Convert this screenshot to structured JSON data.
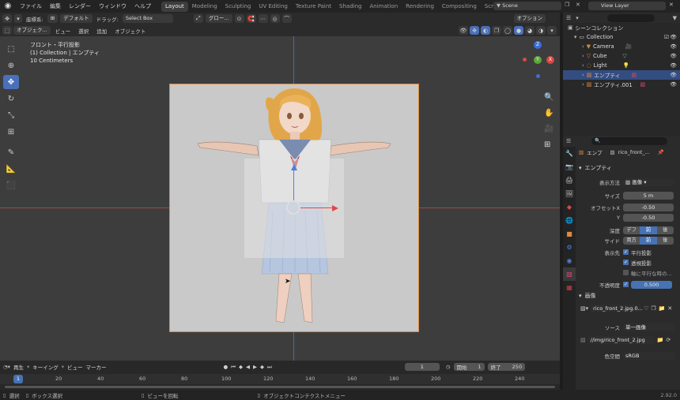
{
  "menu": [
    "ファイル",
    "編集",
    "レンダー",
    "ウィンドウ",
    "ヘルプ"
  ],
  "workspaces": [
    "Layout",
    "Modeling",
    "Sculpting",
    "UV Editing",
    "Texture Paint",
    "Shading",
    "Animation",
    "Rendering",
    "Compositing",
    "Scripting"
  ],
  "scene": "Scene",
  "view_layer": "View Layer",
  "header": {
    "coord_label": "座標系:",
    "coord_value": "デフォルト",
    "drag_label": "ドラッグ:",
    "drag_value": "Select Box",
    "pivot": "グロー...",
    "options": "オプション"
  },
  "header2": {
    "mode": "オブジェク...",
    "items": [
      "ビュー",
      "選択",
      "追加",
      "オブジェクト"
    ]
  },
  "overlay": {
    "view_name": "フロント・平行投影",
    "collection_info": "(1) Collection | エンプティ",
    "scale": "10 Centimeters"
  },
  "gizmo": {
    "z": "Z",
    "y": "Y",
    "x": "X"
  },
  "outliner": {
    "root": "シーンコレクション",
    "collection": "Collection",
    "items": [
      "Camera",
      "Cube",
      "Light",
      "エンプティ",
      "エンプティ.001"
    ]
  },
  "props": {
    "search": "",
    "crumb1": "エンプ",
    "crumb2": "rico_front_...",
    "section": "エンプティ",
    "display_label": "表示方法",
    "display_value": "画像",
    "size_label": "サイズ",
    "size_value": "5 m",
    "offset_x_label": "オフセットX",
    "offset_x": "-0.50",
    "offset_y_label": "Y",
    "offset_y": "-0.50",
    "depth_label": "深度",
    "depth_opts": [
      "デフ",
      "前",
      "後"
    ],
    "side_label": "サイド",
    "side_opts": [
      "両方",
      "前",
      "後"
    ],
    "show_label": "表示先",
    "show_ortho": "平行投影",
    "show_persp": "透視投影",
    "show_axis": "軸に平行な時の...",
    "opacity_label": "不透明度",
    "opacity_value": "0.500",
    "image_section": "画像",
    "image_file": "rico_front_2.jpg.0...",
    "source_label": "ソース",
    "source_value": "単一画像",
    "path_value": "//img/rico_front_2.jpg",
    "colorspace_label": "色空間",
    "colorspace_value": "sRGB"
  },
  "timeline": {
    "playback": "再生",
    "keying": "キーイング",
    "view": "ビュー",
    "marker": "マーカー",
    "current": "1",
    "start_label": "開始",
    "start": "1",
    "end_label": "終了",
    "end": "250",
    "ticks": [
      "1",
      "20",
      "40",
      "60",
      "80",
      "100",
      "120",
      "140",
      "160",
      "180",
      "200",
      "220",
      "240"
    ]
  },
  "status": {
    "select": "選択",
    "box_select": "ボックス選択",
    "rotate": "ビューを回転",
    "context": "オブジェクトコンテクストメニュー",
    "version": "2.92.0"
  }
}
